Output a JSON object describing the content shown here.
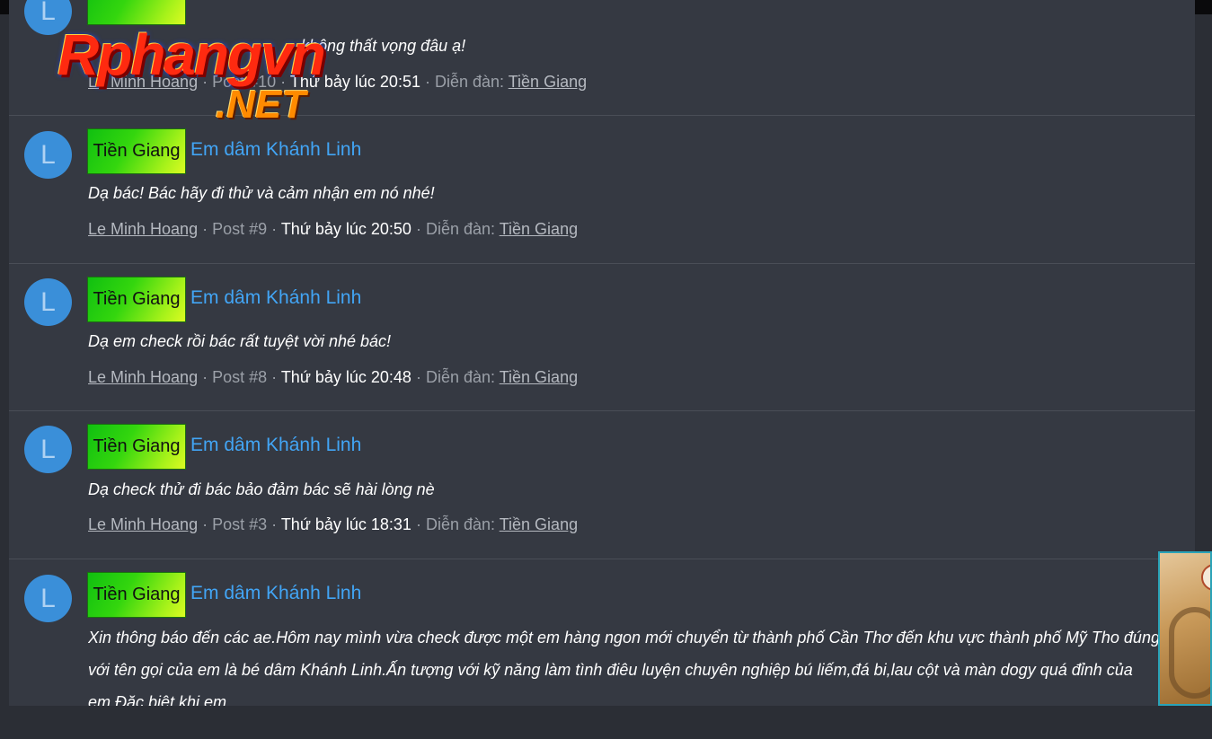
{
  "topbar": {},
  "posts": [
    {
      "avatar": "L",
      "tag": "",
      "title": "",
      "body": "không thất vọng đâu ạ!",
      "author": "Le Minh Hoang",
      "post_no": "Post #10",
      "time": "Thứ bảy lúc 20:51",
      "forum_label": "Diễn đàn:",
      "forum": "Tiền Giang"
    },
    {
      "avatar": "L",
      "tag": "Tiền Giang",
      "title": "Em dâm Khánh Linh",
      "body": "Dạ bác! Bác hãy đi thử và cảm nhận em nó nhé!",
      "author": "Le Minh Hoang",
      "post_no": "Post #9",
      "time": "Thứ bảy lúc 20:50",
      "forum_label": "Diễn đàn:",
      "forum": "Tiền Giang"
    },
    {
      "avatar": "L",
      "tag": "Tiền Giang",
      "title": "Em dâm Khánh Linh",
      "body": "Dạ em check rồi bác rất tuyệt vời nhé bác!",
      "author": "Le Minh Hoang",
      "post_no": "Post #8",
      "time": "Thứ bảy lúc 20:48",
      "forum_label": "Diễn đàn:",
      "forum": "Tiền Giang"
    },
    {
      "avatar": "L",
      "tag": "Tiền Giang",
      "title": "Em dâm Khánh Linh",
      "body": "Dạ check thử đi bác bảo đảm bác sẽ hài lòng nè",
      "author": "Le Minh Hoang",
      "post_no": "Post #3",
      "time": "Thứ bảy lúc 18:31",
      "forum_label": "Diễn đàn:",
      "forum": "Tiền Giang"
    },
    {
      "avatar": "L",
      "tag": "Tiền Giang",
      "title": "Em dâm Khánh Linh",
      "body": "Xin thông báo đến các ae.Hôm nay mình vừa check được một em hàng ngon mới chuyển từ thành phố Cần Thơ đến khu vực thành phố Mỹ Tho đúng với tên gọi của em là bé dâm Khánh Linh.Ấn tượng với kỹ năng làm tình điêu luyện chuyên nghiệp bú liếm,đá bi,lau cột và màn dogy quá đỉnh của em.Đặc biệt khi em",
      "author": "",
      "post_no": "",
      "time": "",
      "forum_label": "",
      "forum": ""
    }
  ],
  "logo": {
    "line1": "Rphangvn",
    "line2": ".NET"
  },
  "colors": {
    "background": "#2b2e35",
    "panel": "#353942",
    "link": "#42a5f5",
    "avatar": "#3a8fd9"
  }
}
